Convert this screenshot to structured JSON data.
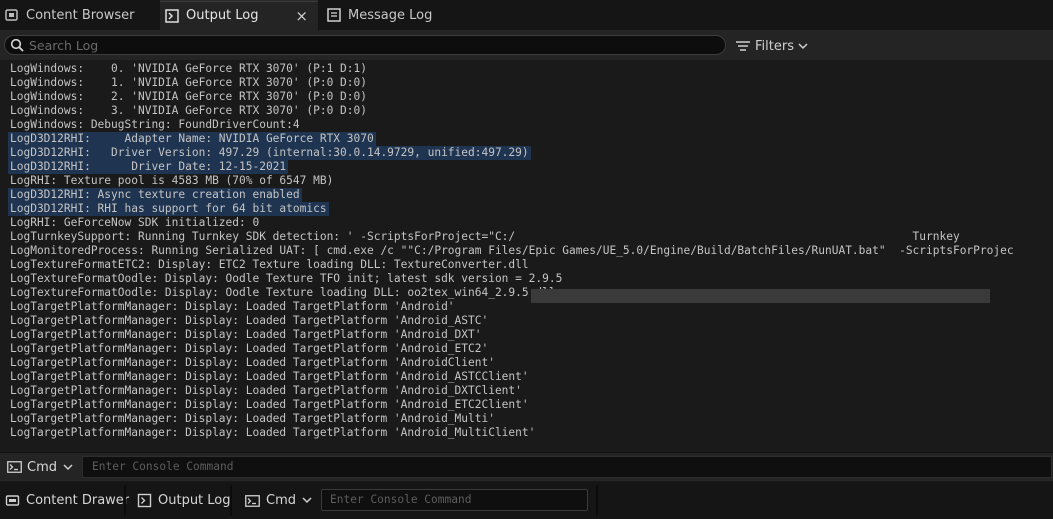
{
  "tabs": [
    {
      "label": "Content Browser",
      "icon": "content-browser-icon",
      "active": false
    },
    {
      "label": "Output Log",
      "icon": "output-log-icon",
      "active": true,
      "close": "×"
    },
    {
      "label": "Message Log",
      "icon": "message-log-icon",
      "active": false
    }
  ],
  "search": {
    "placeholder": "Search Log",
    "filters_label": "Filters"
  },
  "log": {
    "lines": [
      {
        "text": "LogWindows:    0. 'NVIDIA GeForce RTX 3070' (P:1 D:1)",
        "highlighted": false
      },
      {
        "text": "LogWindows:    1. 'NVIDIA GeForce RTX 3070' (P:0 D:0)",
        "highlighted": false
      },
      {
        "text": "LogWindows:    2. 'NVIDIA GeForce RTX 3070' (P:0 D:0)",
        "highlighted": false
      },
      {
        "text": "LogWindows:    3. 'NVIDIA GeForce RTX 3070' (P:0 D:0)",
        "highlighted": false
      },
      {
        "text": "LogWindows: DebugString: FoundDriverCount:4",
        "highlighted": false
      },
      {
        "text": "LogD3D12RHI:     Adapter Name: NVIDIA GeForce RTX 3070",
        "highlighted": true
      },
      {
        "text": "LogD3D12RHI:   Driver Version: 497.29 (internal:30.0.14.9729, unified:497.29)",
        "highlighted": true
      },
      {
        "text": "LogD3D12RHI:      Driver Date: 12-15-2021",
        "highlighted": true
      },
      {
        "text": "LogRHI: Texture pool is 4583 MB (70% of 6547 MB)",
        "highlighted": false
      },
      {
        "text": "LogD3D12RHI: Async texture creation enabled",
        "highlighted": true
      },
      {
        "text": "LogD3D12RHI: RHI has support for 64 bit atomics",
        "highlighted": true
      },
      {
        "text": "LogRHI: GeForceNow SDK initialized: 0",
        "highlighted": false
      },
      {
        "text": "LogTurnkeySupport: Running Turnkey SDK detection: ' -ScriptsForProject=\"C:/                                                           Turnkey",
        "highlighted": false
      },
      {
        "text": "LogMonitoredProcess: Running Serialized UAT: [ cmd.exe /c \"\"C:/Program Files/Epic Games/UE_5.0/Engine/Build/BatchFiles/RunUAT.bat\"  -ScriptsForProjec",
        "highlighted": false
      },
      {
        "text": "LogTextureFormatETC2: Display: ETC2 Texture loading DLL: TextureConverter.dll",
        "highlighted": false
      },
      {
        "text": "LogTextureFormatOodle: Display: Oodle Texture TFO init; latest sdk version = 2.9.5",
        "highlighted": false
      },
      {
        "text": "LogTextureFormatOodle: Display: Oodle Texture loading DLL: oo2tex_win64_2.9.5.dll",
        "highlighted": false
      },
      {
        "text": "LogTargetPlatformManager: Display: Loaded TargetPlatform 'Android'",
        "highlighted": false
      },
      {
        "text": "LogTargetPlatformManager: Display: Loaded TargetPlatform 'Android_ASTC'",
        "highlighted": false
      },
      {
        "text": "LogTargetPlatformManager: Display: Loaded TargetPlatform 'Android_DXT'",
        "highlighted": false
      },
      {
        "text": "LogTargetPlatformManager: Display: Loaded TargetPlatform 'Android_ETC2'",
        "highlighted": false
      },
      {
        "text": "LogTargetPlatformManager: Display: Loaded TargetPlatform 'AndroidClient'",
        "highlighted": false
      },
      {
        "text": "LogTargetPlatformManager: Display: Loaded TargetPlatform 'Android_ASTCClient'",
        "highlighted": false
      },
      {
        "text": "LogTargetPlatformManager: Display: Loaded TargetPlatform 'Android_DXTClient'",
        "highlighted": false
      },
      {
        "text": "LogTargetPlatformManager: Display: Loaded TargetPlatform 'Android_ETC2Client'",
        "highlighted": false
      },
      {
        "text": "LogTargetPlatformManager: Display: Loaded TargetPlatform 'Android_Multi'",
        "highlighted": false
      },
      {
        "text": "LogTargetPlatformManager: Display: Loaded TargetPlatform 'Android_MultiClient'",
        "highlighted": false
      }
    ]
  },
  "console": {
    "cmd_label": "Cmd",
    "placeholder": "Enter Console Command"
  },
  "statusbar": {
    "content_drawer": "Content Drawer",
    "output_log": "Output Log",
    "cmd_label": "Cmd",
    "placeholder": "Enter Console Command"
  },
  "colors": {
    "highlight": "#1e3450",
    "background": "#1a1a1a",
    "panel": "#242424"
  }
}
